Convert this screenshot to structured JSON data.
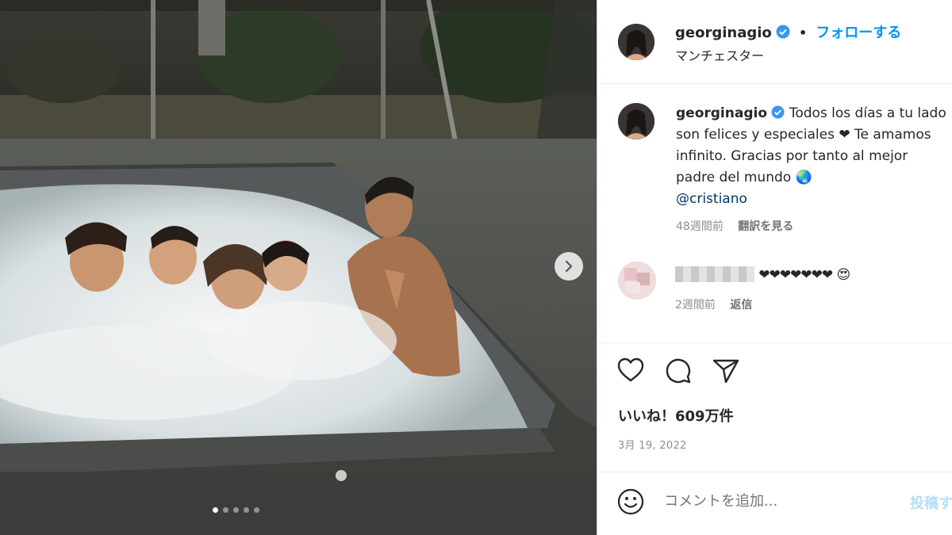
{
  "photo": {
    "description_icon": "photo",
    "next_icon": "chevron-right-icon",
    "carousel_count": 5,
    "carousel_active": 1
  },
  "header": {
    "username": "georginagio",
    "separator": "•",
    "follow_label": "フォローする",
    "location": "マンチェスター"
  },
  "caption": {
    "username": "georginagio",
    "text": "Todos los días a tu lado son felices y especiales ❤ Te amamos infinito. Gracias por tanto al mejor padre del mundo",
    "emoji": "🌏",
    "mention": "@cristiano",
    "time": "48週間前",
    "translate_label": "翻訳を見る"
  },
  "comment": {
    "hearts": "❤❤❤❤❤❤❤",
    "emoji": "😍",
    "time": "2週間前",
    "reply_label": "返信"
  },
  "actions": {
    "like_icon": "heart-icon",
    "comment_icon": "comment-icon",
    "share_icon": "share-icon"
  },
  "likes": "いいね！609万件",
  "date": "3月 19, 2022",
  "comment_box": {
    "placeholder": "コメントを追加...",
    "post_label": "投稿する"
  },
  "colors": {
    "accent": "#0095f6",
    "verified": "#3897f0",
    "text": "#262626",
    "muted": "#8e8e8e"
  }
}
